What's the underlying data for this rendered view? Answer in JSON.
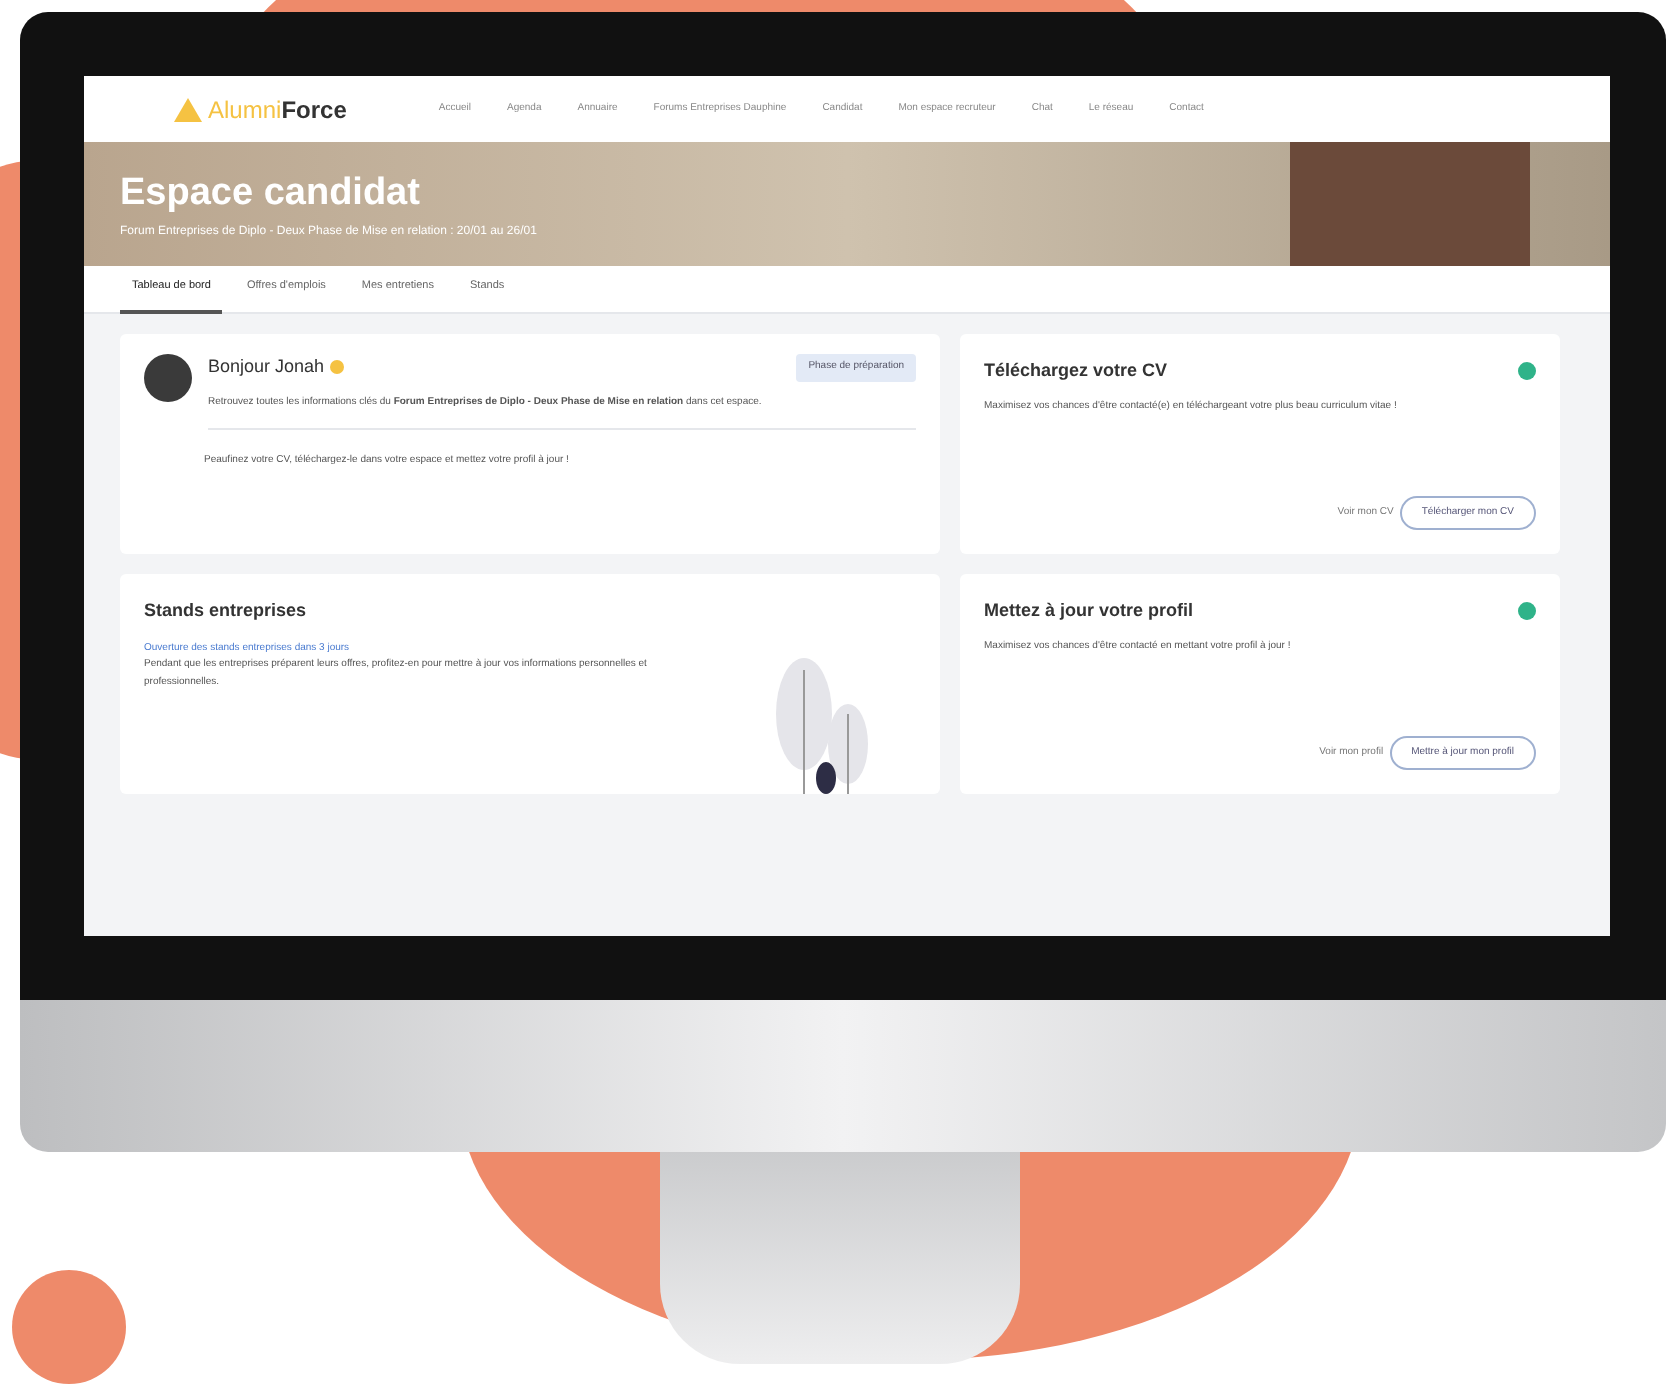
{
  "nav": {
    "logo_light": "Alumni",
    "logo_bold": "Force",
    "items": [
      "Accueil",
      "Agenda",
      "Annuaire",
      "Forums Entreprises Dauphine",
      "Candidat",
      "Mon espace recruteur",
      "Chat",
      "Le réseau",
      "Contact"
    ]
  },
  "banner": {
    "title": "Espace candidat",
    "subtitle": "Forum Entreprises de Diplo - Deux Phase de Mise en relation : 20/01 au 26/01"
  },
  "tabs": [
    {
      "label": "Tableau de bord",
      "selected": true
    },
    {
      "label": "Offres d'emplois",
      "selected": false
    },
    {
      "label": "Mes entretiens",
      "selected": false
    },
    {
      "label": "Stands",
      "selected": false
    }
  ],
  "welcome": {
    "greeting": "Bonjour Jonah",
    "badge": "Phase de préparation",
    "message": "Retrouvez toutes les informations clés du **Forum Entreprises de Diplo - Deux Phase de Mise en relation** dans cet espace.",
    "note": "Peaufinez votre CV, téléchargez-le dans votre espace et mettez votre profil à jour !"
  },
  "cards": [
    {
      "title": "Téléchargez votre CV",
      "text": "Maximisez vos chances d'être contacté(e) en téléchargeant votre plus beau curriculum vitae !",
      "done": true,
      "link": "Voir mon CV",
      "button": "Télécharger mon CV"
    },
    {
      "title": "Mettez à jour votre profil",
      "text": "Maximisez vos chances d'être contacté en mettant votre profil à jour !",
      "done": true,
      "link": "Voir mon profil",
      "button": "Mettre à jour mon profil"
    }
  ],
  "stands": {
    "title": "Stands entreprises",
    "link": "Ouverture des stands entreprises dans 3 jours",
    "text": "Pendant que les entreprises préparent leurs offres, profitez-en pour mettre à jour vos informations personnelles et professionnelles."
  }
}
